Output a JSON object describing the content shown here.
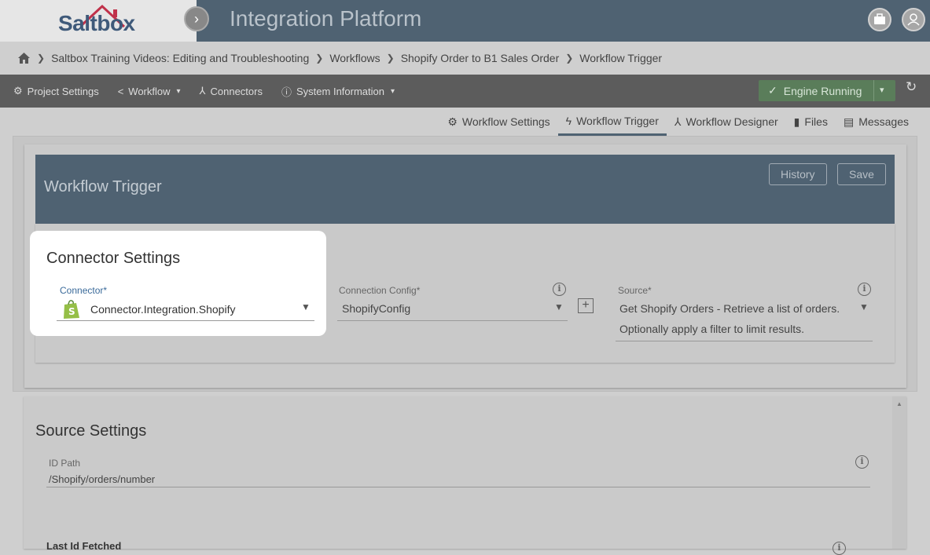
{
  "header": {
    "logo": "Saltbox",
    "app_title": "Integration Platform"
  },
  "breadcrumb": [
    "Saltbox Training Videos: Editing and Troubleshooting",
    "Workflows",
    "Shopify Order to B1 Sales Order",
    "Workflow Trigger"
  ],
  "nav": {
    "project_settings": "Project Settings",
    "workflow": "Workflow",
    "connectors": "Connectors",
    "system_information": "System Information"
  },
  "engine": {
    "label": "Engine Running"
  },
  "tabs": {
    "settings": "Workflow Settings",
    "trigger": "Workflow Trigger",
    "designer": "Workflow Designer",
    "files": "Files",
    "messages": "Messages"
  },
  "panel": {
    "title": "Workflow Trigger",
    "history": "History",
    "save": "Save"
  },
  "connector_settings": {
    "title": "Connector Settings",
    "connector_label": "Connector*",
    "connector_value": "Connector.Integration.Shopify",
    "config_label": "Connection Config*",
    "config_value": "ShopifyConfig",
    "source_label": "Source*",
    "source_value_line1": "Get Shopify Orders - Retrieve a list of orders.",
    "source_value_line2": "Optionally apply a filter to limit results."
  },
  "source_settings": {
    "title": "Source Settings",
    "id_path_label": "ID Path",
    "id_path_value": "/Shopify/orders/number",
    "last_id_label": "Last Id Fetched"
  },
  "colors": {
    "header_bg": "#4f6272",
    "nav_bg": "#5c5c5c",
    "engine_green": "#5a7d5a"
  }
}
